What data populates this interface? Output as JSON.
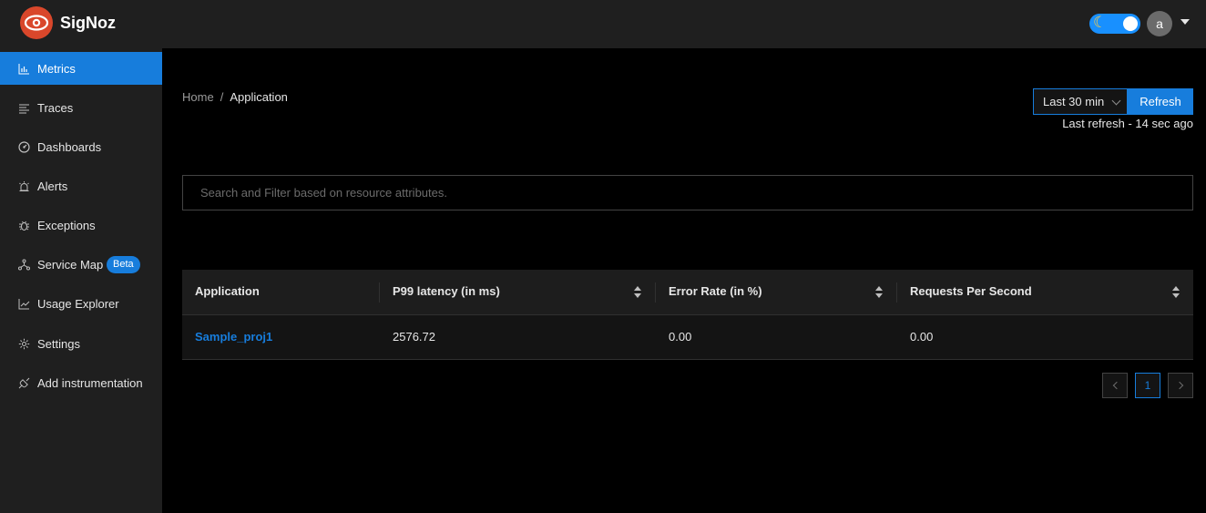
{
  "header": {
    "brand": "SigNoz",
    "avatar_letter": "a",
    "theme_toggle": "on"
  },
  "sidebar": {
    "items": [
      {
        "label": "Metrics",
        "icon": "bar-chart-icon"
      },
      {
        "label": "Traces",
        "icon": "align-left-icon"
      },
      {
        "label": "Dashboards",
        "icon": "dashboard-icon"
      },
      {
        "label": "Alerts",
        "icon": "alarm-icon"
      },
      {
        "label": "Exceptions",
        "icon": "bug-icon"
      },
      {
        "label": "Service Map",
        "icon": "deployment-icon",
        "badge": "Beta"
      },
      {
        "label": "Usage Explorer",
        "icon": "line-chart-icon"
      },
      {
        "label": "Settings",
        "icon": "gear-icon"
      },
      {
        "label": "Add instrumentation",
        "icon": "api-icon"
      }
    ],
    "active_index": 0
  },
  "breadcrumb": {
    "home": "Home",
    "separator": "/",
    "current": "Application"
  },
  "toolbar": {
    "time_range": "Last 30 min",
    "refresh_label": "Refresh",
    "last_refresh": "Last refresh - 14 sec ago"
  },
  "search": {
    "placeholder": "Search and Filter based on resource attributes.",
    "value": ""
  },
  "table": {
    "columns": [
      "Application",
      "P99 latency (in ms)",
      "Error Rate (in %)",
      "Requests Per Second"
    ],
    "rows": [
      {
        "application": "Sample_proj1",
        "p99": "2576.72",
        "error_rate": "0.00",
        "rps": "0.00"
      }
    ]
  },
  "pagination": {
    "current_page": "1"
  },
  "colors": {
    "accent": "#177ddc",
    "logo": "#d9472b",
    "header_bg": "#1f1f1f",
    "page_bg": "#000000"
  }
}
